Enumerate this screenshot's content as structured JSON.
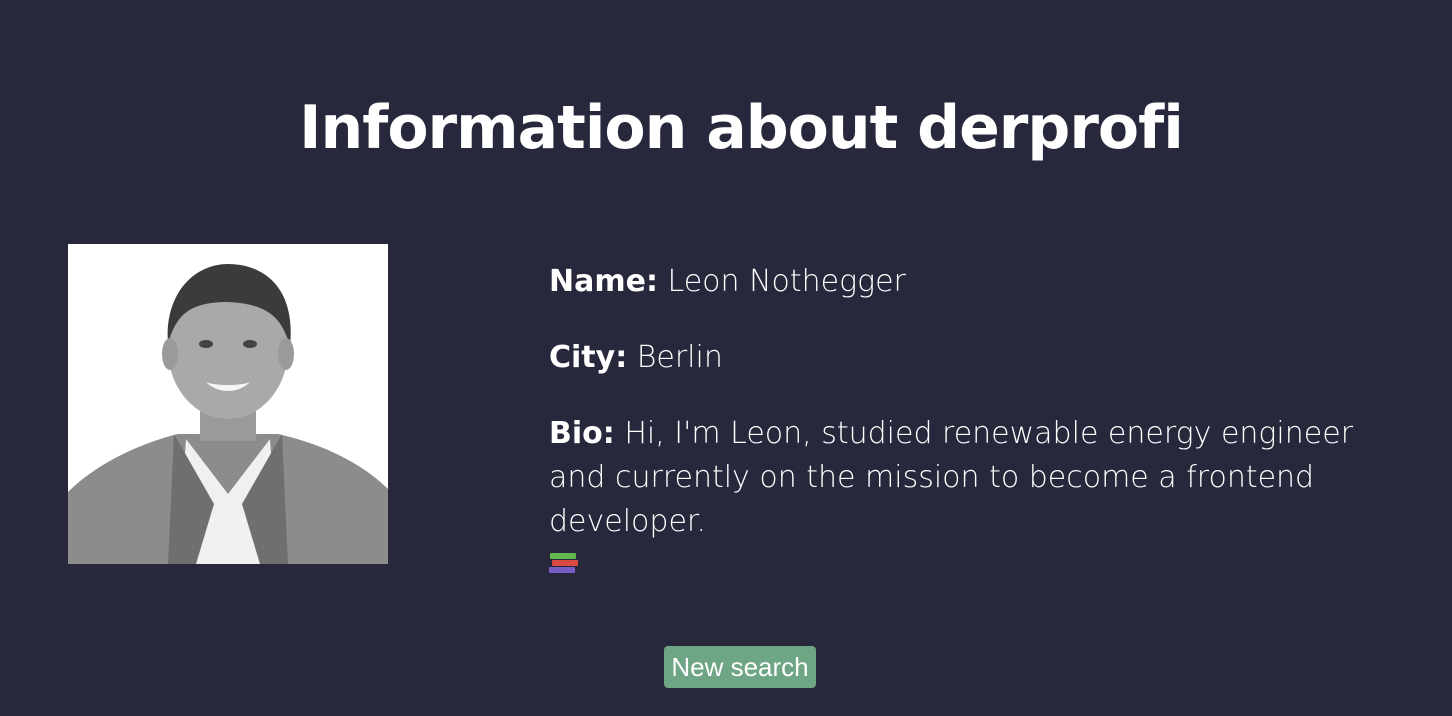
{
  "page": {
    "title": "Information about derprofi"
  },
  "profile": {
    "avatar_icon": "profile-photo",
    "name_label": "Name:",
    "name_value": "Leon Nothegger",
    "city_label": "City:",
    "city_value": "Berlin",
    "bio_label": "Bio:",
    "bio_value": "Hi, I'm Leon, studied renewable energy engineer and currently on the mission to become a frontend developer.",
    "bio_icon": "books-icon"
  },
  "actions": {
    "new_search_label": "New search"
  },
  "colors": {
    "background": "#28283c",
    "text": "#ffffff",
    "button": "#6ea584"
  }
}
